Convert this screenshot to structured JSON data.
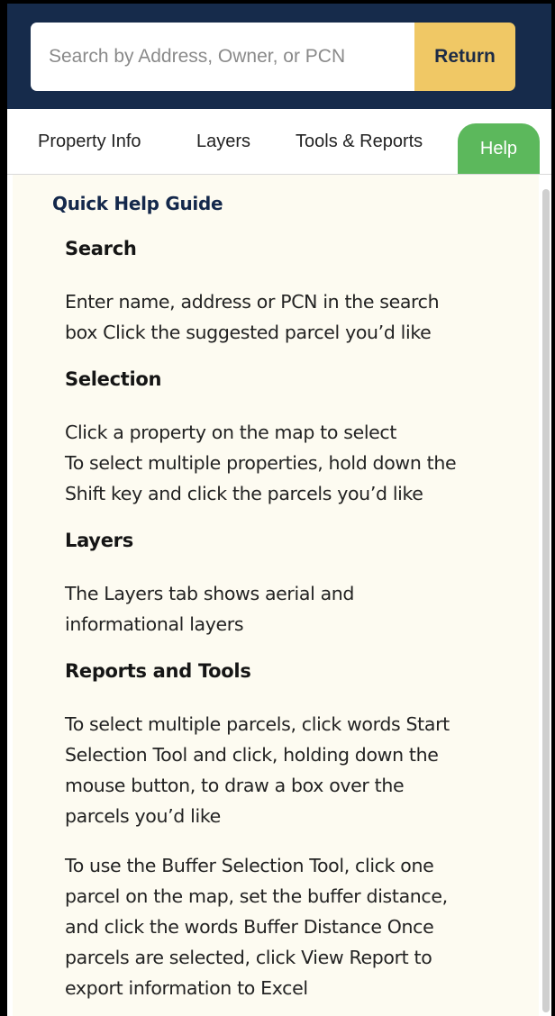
{
  "search": {
    "placeholder": "Search by Address, Owner, or PCN",
    "value": "",
    "button_label": "Return"
  },
  "tabs": [
    {
      "label": "Property Info",
      "active": false
    },
    {
      "label": "Layers",
      "active": false
    },
    {
      "label": "Tools & Reports",
      "active": false
    },
    {
      "label": "Help",
      "active": true
    }
  ],
  "help": {
    "title": "Quick Help Guide",
    "sections": [
      {
        "heading": "Search",
        "paragraphs": [
          [
            "Enter name, address or PCN in the search",
            "box Click the suggested parcel you’d like"
          ]
        ]
      },
      {
        "heading": "Selection",
        "paragraphs": [
          [
            "Click a property on the map to select",
            "To select multiple properties, hold down the",
            "Shift key and click the parcels you’d like"
          ]
        ]
      },
      {
        "heading": "Layers",
        "paragraphs": [
          [
            "The Layers tab shows aerial and",
            "informational layers"
          ]
        ]
      },
      {
        "heading": "Reports and Tools",
        "paragraphs": [
          [
            "To select multiple parcels, click words Start",
            "Selection Tool and click, holding down the",
            "mouse button, to draw a box over the",
            "parcels you’d like"
          ],
          [
            "To use the Buffer Selection Tool, click one",
            "parcel on the map, set the buffer distance,",
            "and click the words Buffer Distance Once",
            "parcels are selected, click View Report to",
            "export information to Excel"
          ]
        ]
      }
    ]
  },
  "colors": {
    "header_bg": "#162b4b",
    "return_button": "#f0c865",
    "help_tab": "#5cb85c",
    "panel_bg": "#fdfbf1",
    "guide_title": "#14284b"
  }
}
